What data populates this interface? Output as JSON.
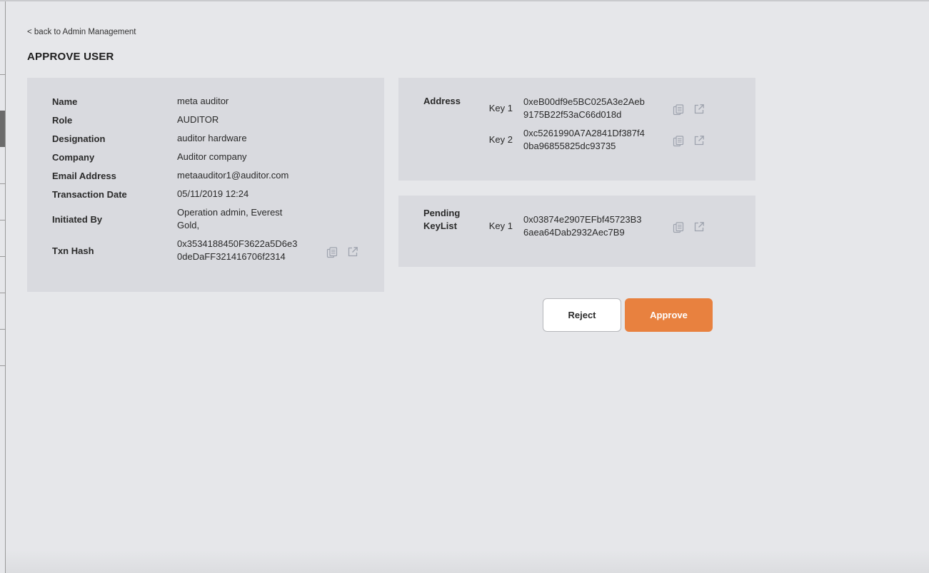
{
  "nav": {
    "back_link": "< back to Admin Management"
  },
  "page": {
    "title": "APPROVE USER"
  },
  "details": {
    "name_label": "Name",
    "name_value": "meta auditor",
    "role_label": "Role",
    "role_value": "AUDITOR",
    "designation_label": "Designation",
    "designation_value": "auditor hardware",
    "company_label": "Company",
    "company_value": "Auditor company",
    "email_label": "Email Address",
    "email_value": "metaauditor1@auditor.com",
    "txn_date_label": "Transaction Date",
    "txn_date_value": "05/11/2019 12:24",
    "initiated_label": "Initiated By",
    "initiated_value": "Operation admin, Everest Gold,",
    "txn_hash_label": "Txn Hash",
    "txn_hash_value": "0x3534188450F3622a5D6e30deDaFF321416706f2314"
  },
  "address": {
    "label": "Address",
    "keys": [
      {
        "label": "Key 1",
        "value": "0xeB00df9e5BC025A3e2Aeb9175B22f53aC66d018d"
      },
      {
        "label": "Key 2",
        "value": "0xc5261990A7A2841Df387f40ba96855825dc93735"
      }
    ]
  },
  "pending": {
    "label": "Pending KeyList",
    "keys": [
      {
        "label": "Key 1",
        "value": "0x03874e2907EFbf45723B36aea64Dab2932Aec7B9"
      }
    ]
  },
  "actions": {
    "reject_label": "Reject",
    "approve_label": "Approve"
  },
  "icons": {
    "copy": "copy-icon",
    "external": "external-link-icon"
  },
  "colors": {
    "approve": "#e8813f",
    "card": "#d9dadf",
    "background": "#e6e7ea"
  }
}
